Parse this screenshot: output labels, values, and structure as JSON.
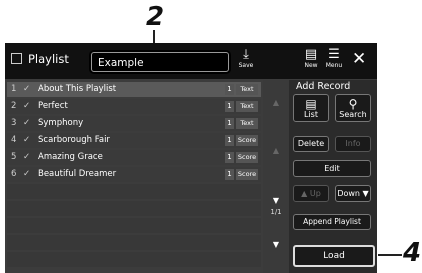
{
  "callouts": {
    "top": "2",
    "right": "4"
  },
  "header": {
    "title": "Playlist",
    "playlist_name": "Example",
    "save_label": "Save",
    "new_label": "New",
    "menu_label": "Menu"
  },
  "list": {
    "rows": [
      {
        "num": "1",
        "check": "✓",
        "name": "About This Playlist",
        "count": "1",
        "type": "Text",
        "selected": true
      },
      {
        "num": "2",
        "check": "✓",
        "name": "Perfect",
        "count": "1",
        "type": "Text"
      },
      {
        "num": "3",
        "check": "✓",
        "name": "Symphony",
        "count": "1",
        "type": "Text"
      },
      {
        "num": "4",
        "check": "✓",
        "name": "Scarborough Fair",
        "count": "1",
        "type": "Score"
      },
      {
        "num": "5",
        "check": "✓",
        "name": "Amazing Grace",
        "count": "1",
        "type": "Score"
      },
      {
        "num": "6",
        "check": "✓",
        "name": "Beautiful Dreamer",
        "count": "1",
        "type": "Score"
      }
    ],
    "page": "1/1"
  },
  "right_panel": {
    "add_record": "Add Record",
    "list_label": "List",
    "search_label": "Search",
    "delete_label": "Delete",
    "info_label": "Info",
    "edit_label": "Edit",
    "up_label": "Up",
    "down_label": "Down",
    "append_label": "Append Playlist",
    "load_label": "Load"
  }
}
